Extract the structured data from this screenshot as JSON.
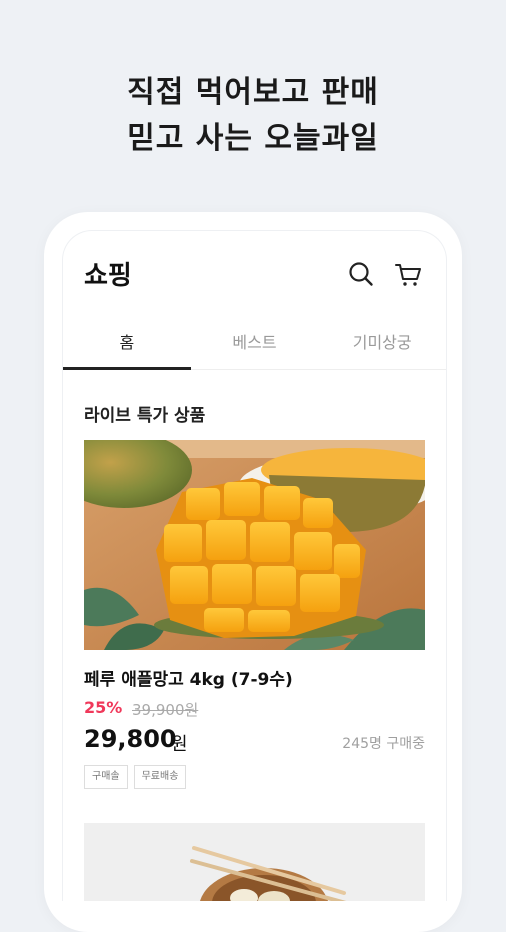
{
  "promo": {
    "line1": "직접 먹어보고 판매",
    "line2": "믿고 사는 오늘과일"
  },
  "header": {
    "title": "쇼핑",
    "search_icon": "search-icon",
    "cart_icon": "cart-icon"
  },
  "tabs": [
    {
      "label": "홈",
      "active": true
    },
    {
      "label": "베스트",
      "active": false
    },
    {
      "label": "기미상궁",
      "active": false
    }
  ],
  "section": {
    "title": "라이브 특가 상품"
  },
  "product": {
    "name": "페루 애플망고 4kg (7-9수)",
    "discount": "25%",
    "original_price": "39,900원",
    "price": "29,800",
    "price_unit": "원",
    "buyers": "245명 구매중",
    "badges": [
      "구매솔",
      "무료배송"
    ]
  },
  "colors": {
    "accent_discount": "#f0385a",
    "background": "#eef1f5"
  }
}
